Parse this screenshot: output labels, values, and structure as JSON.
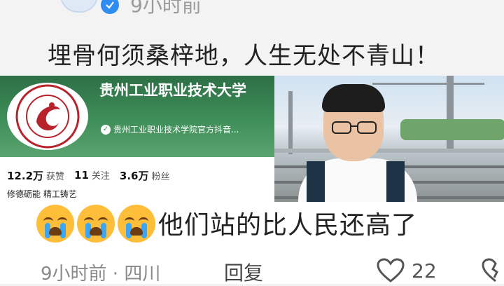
{
  "top_post": {
    "time": "9小时前",
    "quote": "埋骨何须桑梓地，人生无处不青山！"
  },
  "profile_card": {
    "name": "贵州工业职业技术大学",
    "subtitle": "贵州工业职业技术学院官方抖音...",
    "likes_value": "12.2万",
    "likes_label": "获赞",
    "following_value": "11",
    "following_label": "关注",
    "followers_value": "3.6万",
    "followers_label": "粉丝",
    "motto": "修德砺能 精工铸艺"
  },
  "comment": {
    "emojis": [
      "crying-face-icon",
      "crying-face-icon",
      "crying-face-icon"
    ],
    "text": "他们站的比人民还高了",
    "meta": "9小时前 · 四川",
    "reply_label": "回复",
    "like_count": "22"
  },
  "colors": {
    "card_green": "#3f8f59",
    "verified_blue": "#2f8cf0",
    "emoji_yellow": "#ffbe3a"
  }
}
